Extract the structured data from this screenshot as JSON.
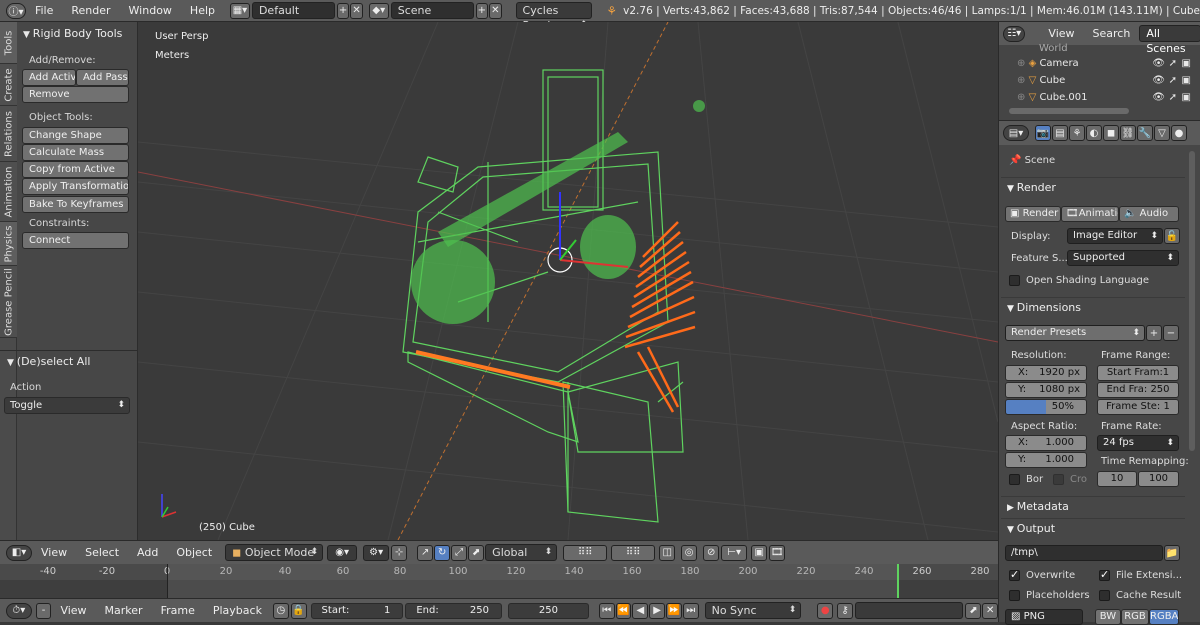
{
  "topbar": {
    "menus": [
      "File",
      "Render",
      "Window",
      "Help"
    ],
    "layout": "Default",
    "scene": "Scene",
    "engine": "Cycles Render",
    "stats": "v2.76 | Verts:43,862 | Faces:43,688 | Tris:87,544 | Objects:46/46 | Lamps:1/1 | Mem:46.01M (143.11M) | Cube"
  },
  "tabs": [
    "Tools",
    "Create",
    "Relations",
    "Animation",
    "Physics",
    "Grease Pencil"
  ],
  "toolshelf": {
    "rigid_title": "Rigid Body Tools",
    "add_remove": "Add/Remove:",
    "add_active": "Add Activ",
    "add_passive": "Add Passi",
    "remove": "Remove",
    "object_tools": "Object Tools:",
    "change_shape": "Change Shape",
    "calc_mass": "Calculate Mass",
    "copy_active": "Copy from Active",
    "apply_transform": "Apply Transformation",
    "bake": "Bake To Keyframes",
    "constraints": "Constraints:",
    "connect": "Connect",
    "deselect_title": "(De)select All",
    "action_label": "Action",
    "action_value": "Toggle"
  },
  "viewport": {
    "persp": "User Persp",
    "units": "Meters",
    "object_label": "(250) Cube"
  },
  "view_header": {
    "menus": [
      "View",
      "Select",
      "Add",
      "Object"
    ],
    "mode": "Object Mode",
    "orientation": "Global"
  },
  "timeline": {
    "ticks": [
      "-40",
      "-20",
      "0",
      "20",
      "40",
      "60",
      "80",
      "100",
      "120",
      "140",
      "160",
      "180",
      "200",
      "220",
      "240",
      "260",
      "280"
    ],
    "menus": [
      "View",
      "Marker",
      "Frame",
      "Playback"
    ],
    "start_label": "Start:",
    "start_value": "1",
    "end_label": "End:",
    "end_value": "250",
    "current": "250",
    "sync": "No Sync"
  },
  "outliner": {
    "tabs": [
      "View",
      "Search",
      "All Scenes"
    ],
    "rows": [
      "World",
      "Camera",
      "Cube",
      "Cube.001"
    ]
  },
  "properties": {
    "scene": "Scene",
    "render_section": "Render",
    "render_btn": "Render",
    "anim_btn": "Animatio",
    "audio_btn": "Audio",
    "display_label": "Display:",
    "display_value": "Image Editor",
    "feature_label": "Feature S...",
    "feature_value": "Supported",
    "osl": "Open Shading Language",
    "dimensions": "Dimensions",
    "presets": "Render Presets",
    "resolution": "Resolution:",
    "res_x": "X:",
    "res_x_val": "1920 px",
    "res_y": "Y:",
    "res_y_val": "1080 px",
    "res_pct": "50%",
    "frame_range": "Frame Range:",
    "start_frame": "Start Fram:1",
    "end_frame": "End Fra: 250",
    "frame_step": "Frame Ste: 1",
    "aspect": "Aspect Ratio:",
    "asp_x": "X:",
    "asp_x_val": "1.000",
    "asp_y": "Y:",
    "asp_y_val": "1.000",
    "frame_rate": "Frame Rate:",
    "fps": "24 fps",
    "time_remap": "Time Remapping:",
    "remap_old": "10",
    "remap_new": "100",
    "border": "Bor",
    "crop": "Cro",
    "metadata": "Metadata",
    "output": "Output",
    "path": "/tmp\\",
    "overwrite": "Overwrite",
    "file_ext": "File Extensi...",
    "placeholders": "Placeholders",
    "cache": "Cache Result",
    "format": "PNG",
    "bw": "BW",
    "rgb": "RGB",
    "rgba": "RGBA"
  }
}
